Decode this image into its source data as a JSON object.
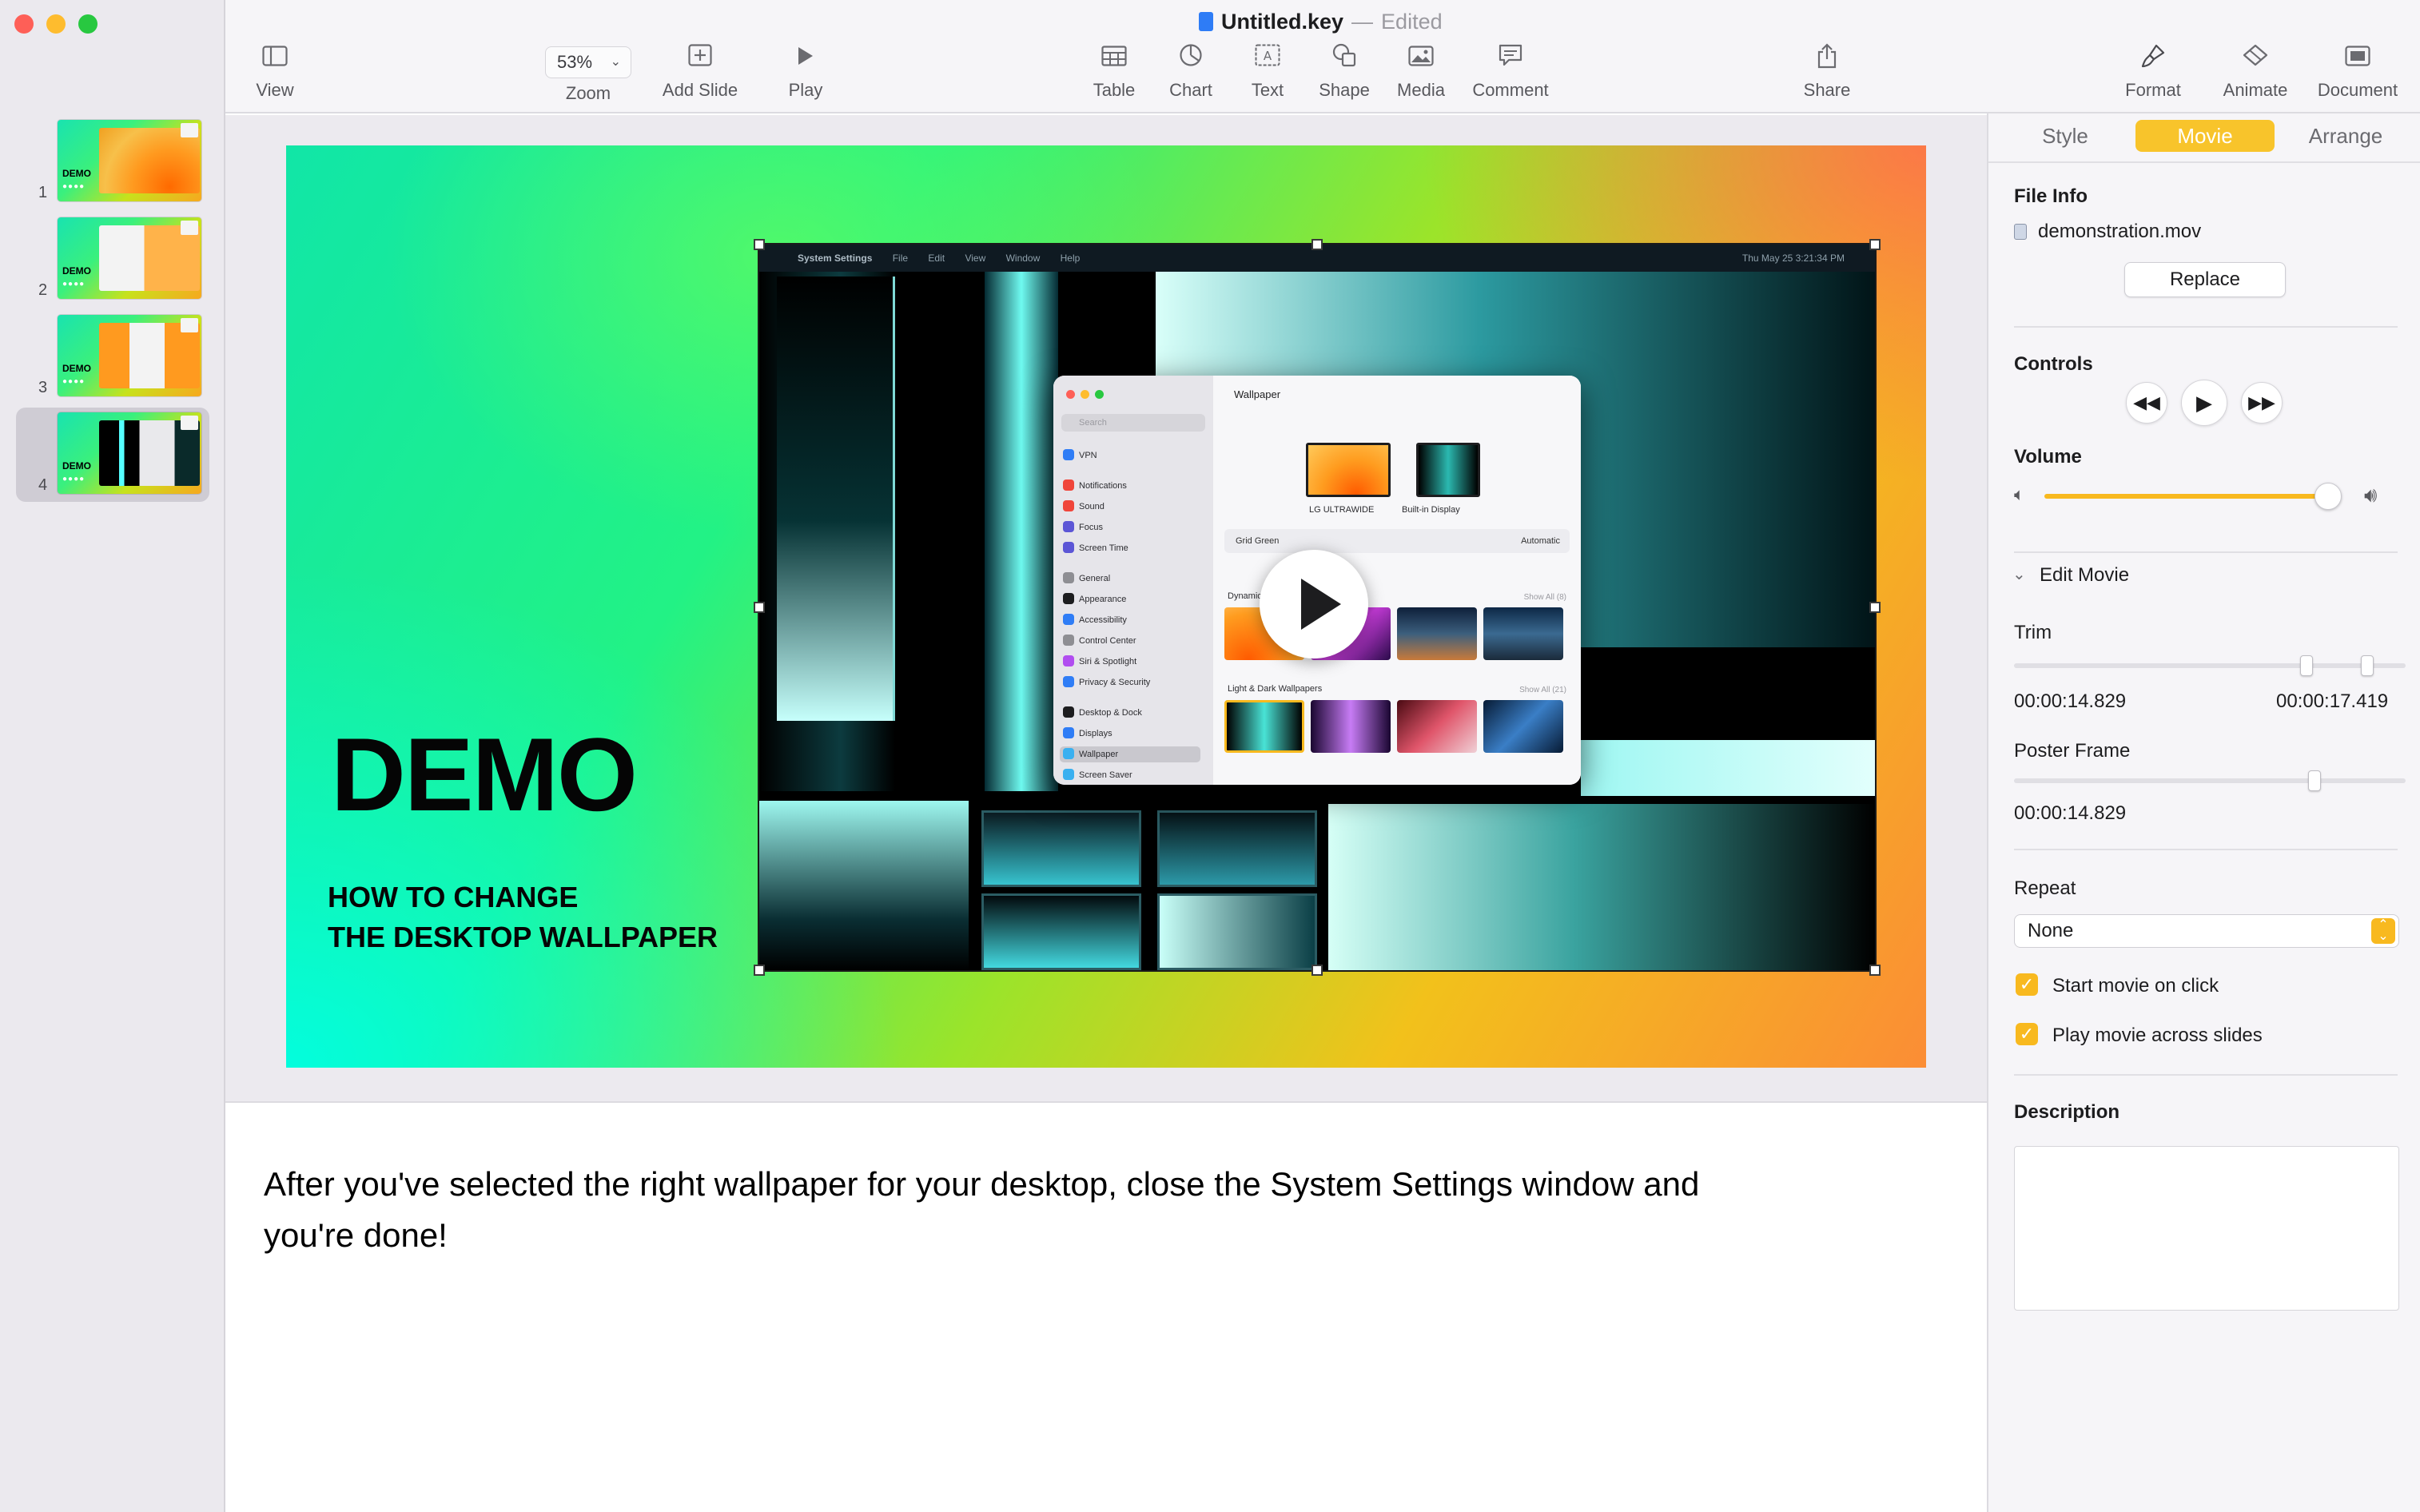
{
  "window": {
    "title": "Untitled.key",
    "title_separator": "—",
    "state": "Edited"
  },
  "toolbar": {
    "view": "View",
    "zoom_value": "53%",
    "zoom": "Zoom",
    "add_slide": "Add Slide",
    "play": "Play",
    "table": "Table",
    "chart": "Chart",
    "text": "Text",
    "shape": "Shape",
    "media": "Media",
    "comment": "Comment",
    "share": "Share",
    "format": "Format",
    "animate": "Animate",
    "document": "Document"
  },
  "navigator": {
    "slides": [
      {
        "number": "1",
        "label": "DEMO"
      },
      {
        "number": "2",
        "label": "DEMO"
      },
      {
        "number": "3",
        "label": "DEMO"
      },
      {
        "number": "4",
        "label": "DEMO"
      }
    ],
    "selected_index": 4
  },
  "slide": {
    "title": "DEMO",
    "subtitle_line1": "HOW TO CHANGE",
    "subtitle_line2": "THE DESKTOP WALLPAPER",
    "movie": {
      "menubar": [
        "System Settings",
        "File",
        "Edit",
        "View",
        "Window",
        "Help"
      ],
      "menubar_clock": "Thu May 25  3:21:34 PM",
      "settings": {
        "search_placeholder": "Search",
        "sidebar_items": [
          "VPN",
          "Notifications",
          "Sound",
          "Focus",
          "Screen Time",
          "General",
          "Appearance",
          "Accessibility",
          "Control Center",
          "Siri & Spotlight",
          "Privacy & Security",
          "Desktop & Dock",
          "Displays",
          "Wallpaper",
          "Screen Saver"
        ],
        "pane_title": "Wallpaper",
        "display_1": "LG ULTRAWIDE",
        "display_2": "Built-in Display",
        "wallpaper_name": "Grid Green",
        "wallpaper_mode": "Automatic",
        "section_dynamic": "Dynamic",
        "show_all_dynamic": "Show All (8)",
        "section_light_dark": "Light & Dark Wallpapers",
        "show_all_light_dark": "Show All (21)"
      }
    }
  },
  "notes": {
    "text": "After you've selected the right wallpaper for your desktop, close the System Settings window and you're done!"
  },
  "inspector": {
    "tabs": [
      "Style",
      "Movie",
      "Arrange"
    ],
    "active_tab": "Movie",
    "file_info_title": "File Info",
    "file_name": "demonstration.mov",
    "replace": "Replace",
    "controls_title": "Controls",
    "volume_title": "Volume",
    "volume_level": 0.96,
    "edit_movie": "Edit Movie",
    "trim_title": "Trim",
    "trim_start": "00:00:14.829",
    "trim_end": "00:00:17.419",
    "poster_frame_title": "Poster Frame",
    "poster_frame_time": "00:00:14.829",
    "repeat_title": "Repeat",
    "repeat_value": "None",
    "start_on_click": "Start movie on click",
    "play_across_slides": "Play movie across slides",
    "description_title": "Description",
    "description_value": ""
  },
  "colors": {
    "accent": "#f8b91f",
    "close": "#fe5f57",
    "minimize": "#febc2e",
    "zoom": "#28c840"
  }
}
